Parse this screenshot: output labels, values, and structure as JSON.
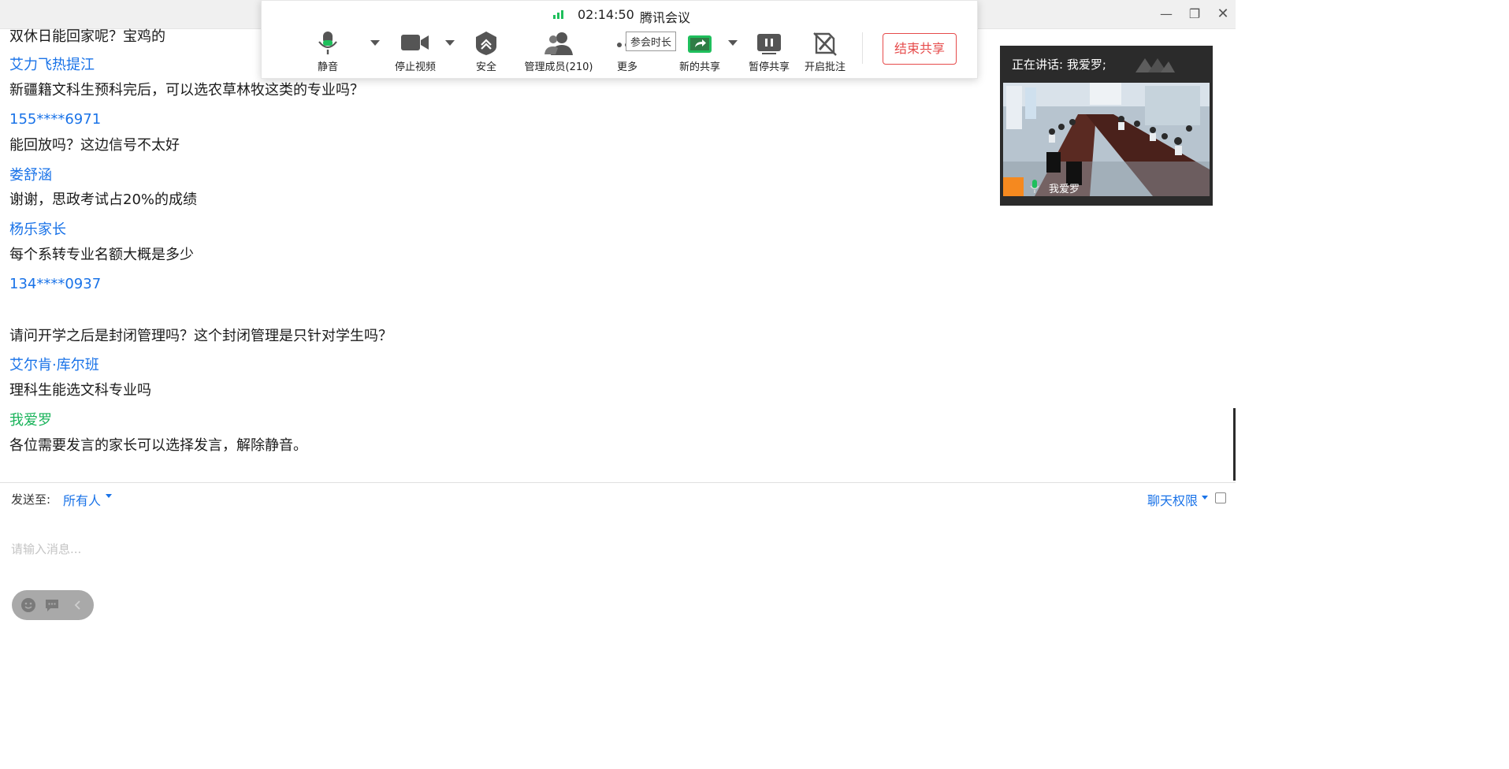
{
  "meeting": {
    "timer": "02:14:50",
    "app_name": "腾讯会议",
    "toolbar": {
      "mute": "静音",
      "stop_video": "停止视频",
      "security": "安全",
      "manage_members": "管理成员(210)",
      "more": "更多",
      "tooltip": "参会时长",
      "new_share": "新的共享",
      "pause_share": "暂停共享",
      "annotate": "开启批注",
      "end_share": "结束共享"
    },
    "video": {
      "speaking": "正在讲话: 我爱罗;",
      "name": "我爱罗"
    }
  },
  "chat": {
    "messages": [
      {
        "text": "双休日能回家呢？宝鸡的"
      },
      {
        "sender": "艾力飞热提江",
        "text": "新疆籍文科生预科完后，可以选农草林牧这类的专业吗？"
      },
      {
        "sender": "155****6971",
        "text": "能回放吗？这边信号不太好"
      },
      {
        "sender": "娄舒涵",
        "text": "谢谢，思政考试占20%的成绩"
      },
      {
        "sender": "杨乐家长",
        "text": "每个系转专业名额大概是多少"
      },
      {
        "sender": "134****0937",
        "text": "请问开学之后是封闭管理吗？这个封闭管理是只针对学生吗？"
      },
      {
        "sender": "艾尔肯·库尔班",
        "text": "理科生能选文科专业吗"
      },
      {
        "sender": "我爱罗",
        "text": "各位需要发言的家长可以选择发言，解除静音。"
      }
    ]
  },
  "composer": {
    "send_to_label": "发送至:",
    "send_to_value": "所有人",
    "permission": "聊天权限",
    "placeholder": "请输入消息..."
  },
  "colors": {
    "sender": "#1a73e8",
    "self_sender": "#19b35a",
    "end_share": "#e64b4b",
    "mic_green": "#1fbf5c"
  }
}
